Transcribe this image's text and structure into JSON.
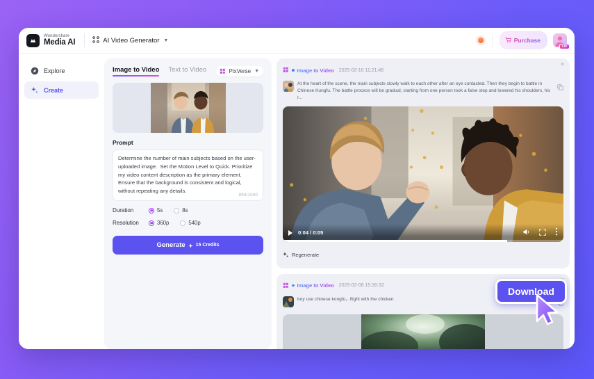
{
  "brand": {
    "company": "Wondershare",
    "product": "Media AI",
    "module": "AI Video Generator"
  },
  "topbar": {
    "purchase_label": "Purchase",
    "vip_badge": "VIP",
    "notification": "notification-dot"
  },
  "sidebar": {
    "items": [
      {
        "label": "Explore",
        "icon": "compass-icon",
        "active": false
      },
      {
        "label": "Create",
        "icon": "sparkle-icon",
        "active": true
      }
    ]
  },
  "center": {
    "tabs": [
      {
        "label": "Image to Video",
        "active": true
      },
      {
        "label": "Text to Video",
        "active": false
      }
    ],
    "model": "PixVerse",
    "prompt_label": "Prompt",
    "prompt_value": "Determine the number of main subjects based on the user-uploaded image.  Set the Motion Level to Quick. Prioritize my video content description as the primary element. Ensure that the background is consistent and logical, without repeating any details.",
    "char_count": "894/1000",
    "duration_label": "Duration",
    "duration_options": [
      {
        "label": "5s",
        "selected": true
      },
      {
        "label": "8s",
        "selected": false
      }
    ],
    "resolution_label": "Resolution",
    "resolution_options": [
      {
        "label": "360p",
        "selected": true
      },
      {
        "label": "540p",
        "selected": false
      }
    ],
    "generate_label": "Generate",
    "generate_credits": "15 Credits"
  },
  "results": [
    {
      "type": "Image to Video",
      "time": "2025-02-10 11:21:46",
      "prompt": "At the heart of the scene, the main subjects slowly walk to each other after an eye contacted. Then they begin to battle in Chinese Kungfu. The battle process will be gradual, starting from one person took a false step and lowered his shoulders, his r...",
      "video_time": "0:04 / 0:05",
      "regenerate_label": "Regenerate"
    },
    {
      "type": "Image to Video",
      "time": "2025-02-08 15:30:32",
      "prompt": "boy use chinese kongfu，flight with the chicken"
    }
  ],
  "download": {
    "label": "Download"
  },
  "colors": {
    "accent": "#5b52f0",
    "background_gradient_start": "#9a63f5",
    "background_gradient_end": "#5d58fb",
    "panel_bg": "#f5f6fa",
    "result_bg": "#eef0f5",
    "radio_selected": "#a23df0"
  }
}
